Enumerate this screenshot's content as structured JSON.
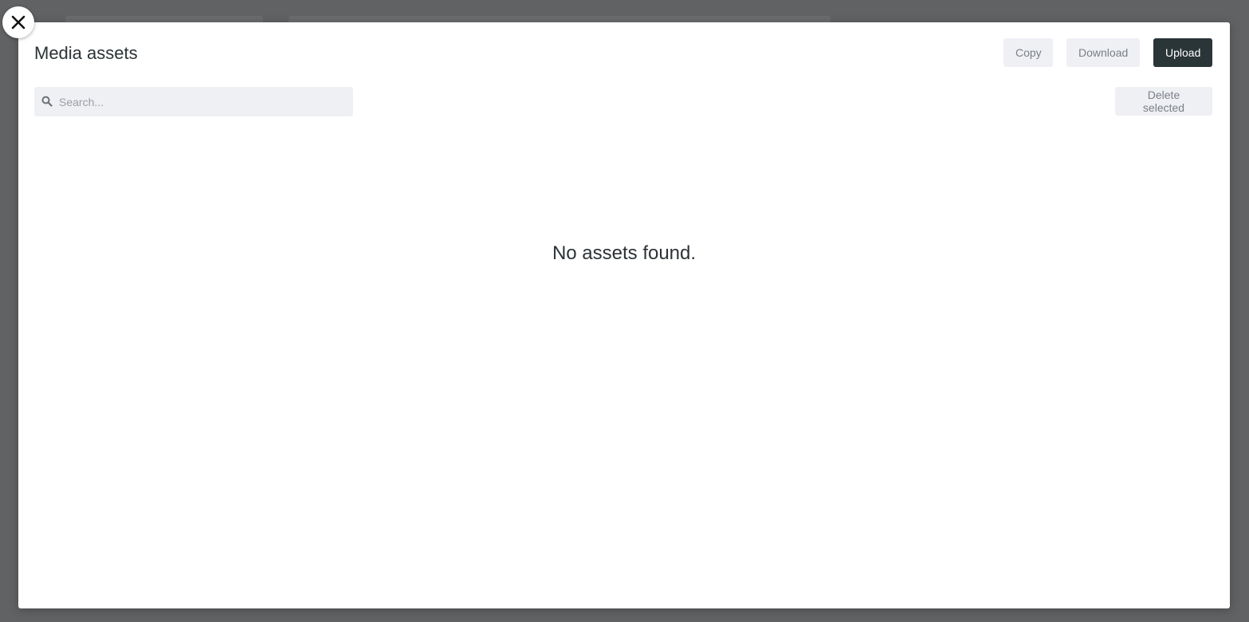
{
  "modal": {
    "title": "Media assets",
    "close_icon": "close-icon"
  },
  "toolbar": {
    "copy_label": "Copy",
    "download_label": "Download",
    "upload_label": "Upload",
    "delete_selected_label": "Delete selected"
  },
  "search": {
    "placeholder": "Search...",
    "value": "",
    "icon": "search-icon"
  },
  "assets": {
    "empty_message": "No assets found.",
    "items": []
  },
  "colors": {
    "overlay": "#616264",
    "primary_button": "#2a3538",
    "secondary_button": "#eff0f4",
    "text": "#2c3235"
  }
}
